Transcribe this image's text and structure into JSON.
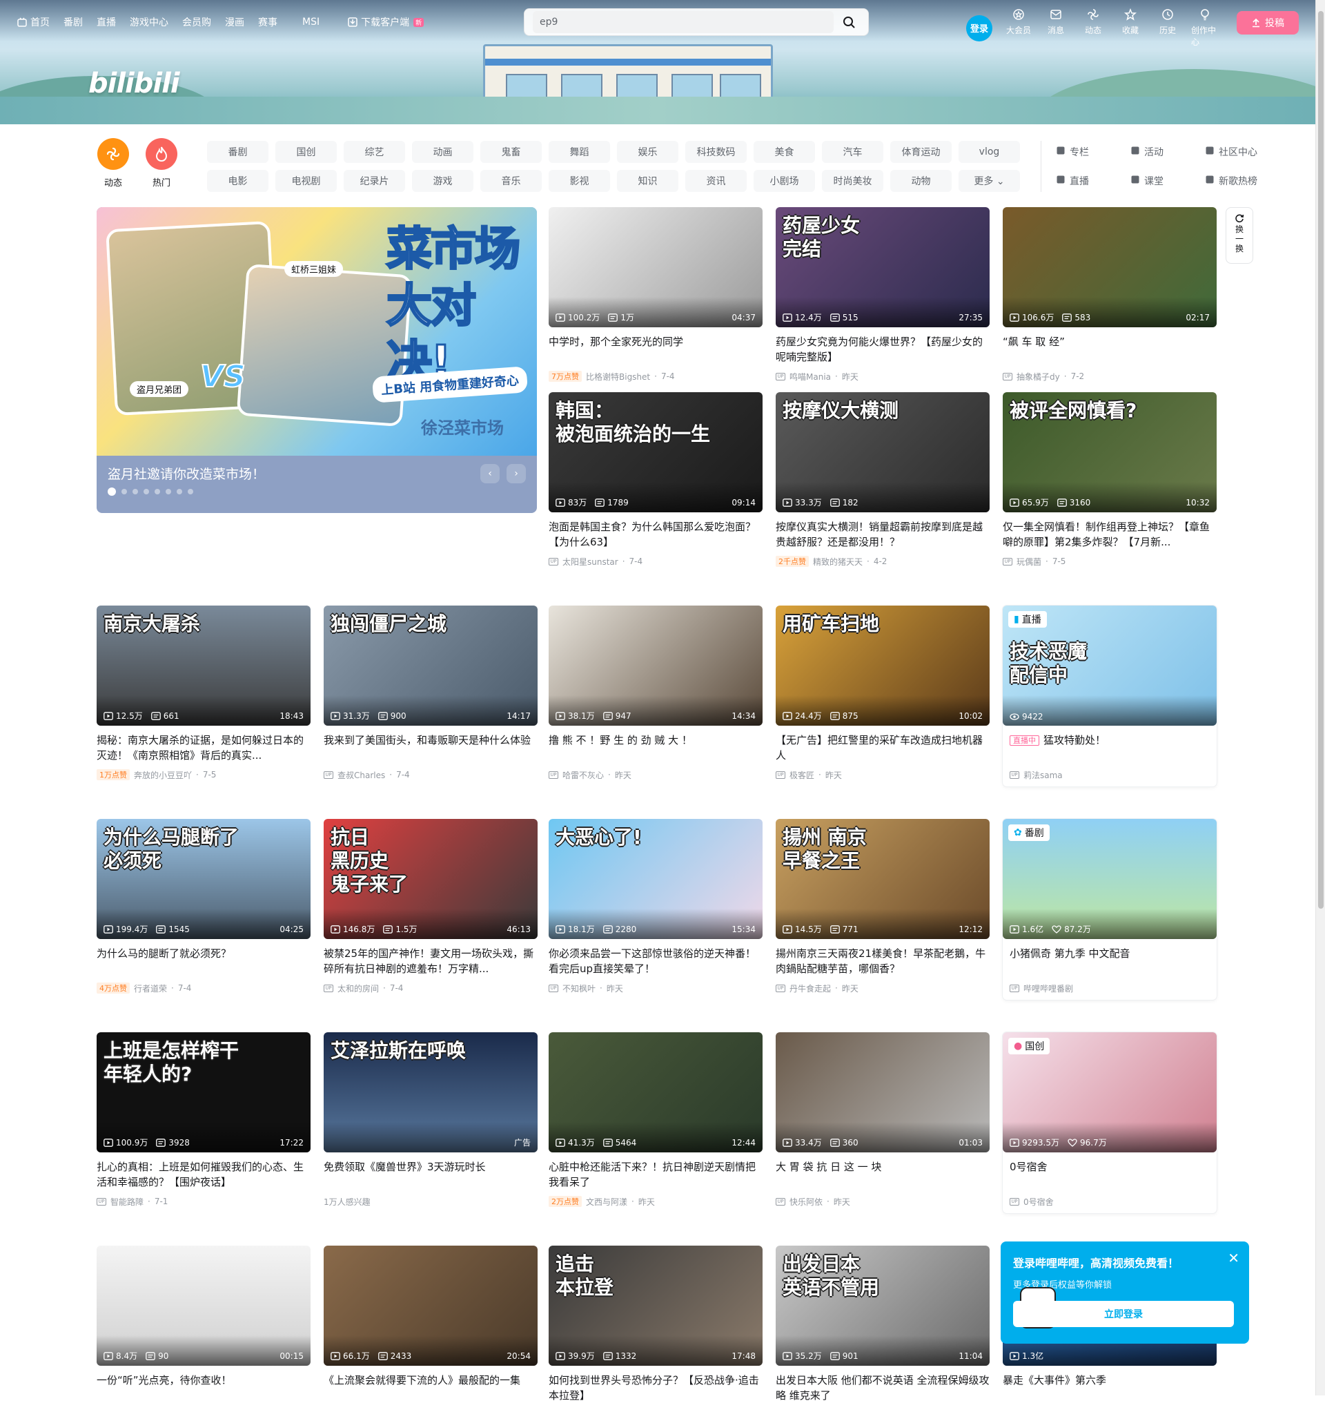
{
  "header": {
    "nav": [
      {
        "label": "首页",
        "icon": "home-icon"
      },
      {
        "label": "番剧"
      },
      {
        "label": "直播"
      },
      {
        "label": "游戏中心"
      },
      {
        "label": "会员购"
      },
      {
        "label": "漫画"
      },
      {
        "label": "赛事"
      },
      {
        "label": "MSI"
      },
      {
        "label": "下载客户端",
        "icon": "download-icon",
        "badge": "新"
      }
    ],
    "search_value": "ep9",
    "login_label": "登录",
    "right_items": [
      {
        "label": "大会员",
        "icon": "vip-icon"
      },
      {
        "label": "消息",
        "icon": "message-icon"
      },
      {
        "label": "动态",
        "icon": "dynamic-icon"
      },
      {
        "label": "收藏",
        "icon": "star-icon"
      },
      {
        "label": "历史",
        "icon": "history-icon"
      },
      {
        "label": "创作中心",
        "icon": "creator-icon"
      }
    ],
    "upload_label": "投稿",
    "logo": "bilibili"
  },
  "channels": {
    "big": [
      {
        "label": "动态",
        "color": "#ff9212"
      },
      {
        "label": "热门",
        "color": "#f9645d"
      }
    ],
    "items": [
      "番剧",
      "国创",
      "综艺",
      "动画",
      "鬼畜",
      "舞蹈",
      "娱乐",
      "科技数码",
      "美食",
      "汽车",
      "体育运动",
      "vlog",
      "电影",
      "电视剧",
      "纪录片",
      "游戏",
      "音乐",
      "影视",
      "知识",
      "资讯",
      "小剧场",
      "时尚美妆",
      "动物",
      "更多"
    ],
    "ext": [
      {
        "label": "专栏"
      },
      {
        "label": "活动"
      },
      {
        "label": "社区中心"
      },
      {
        "label": "直播"
      },
      {
        "label": "课堂"
      },
      {
        "label": "新歌热榜"
      }
    ]
  },
  "carousel": {
    "caption": "盗月社邀请你改造菜市场！",
    "art_title": "菜市场\n大对决!",
    "art_sub": "上B站 用食物重建好奇心",
    "tag_left": "盗月兄弟团",
    "tag_right": "虹桥三姐妹",
    "vs": "VS",
    "watermark": "徐泾菜市场",
    "dots": 8
  },
  "refresh_label": "换一换",
  "cards": [
    {
      "title": "中学时，那个全家死光的同学",
      "plays": "100.2万",
      "danmaku": "1万",
      "dur": "04:37",
      "author": "比格谢特Bigshet",
      "date": "7-4",
      "badge": "7万点赞",
      "thumb_text": "",
      "bg": "linear-gradient(135deg,#f0f0f0,#9a9a9a)"
    },
    {
      "title": "药屋少女究竟为何能火爆世界？【药屋少女的呢喃完整版】",
      "plays": "12.4万",
      "danmaku": "515",
      "dur": "27:35",
      "author": "鸣喵Mania",
      "date": "昨天",
      "thumb_text": "药屋少女\n完结",
      "bg": "linear-gradient(135deg,#6a4a7a,#2b2b4d)"
    },
    {
      "title": "“飙 车 取 经”",
      "plays": "106.6万",
      "danmaku": "583",
      "dur": "02:17",
      "author": "抽象橘子dy",
      "date": "7-2",
      "thumb_text": "",
      "bg": "linear-gradient(135deg,#7a5a2a,#3f6a3a)"
    },
    {
      "title": "泡面是韩国主食？为什么韩国那么爱吃泡面？【为什么63】",
      "plays": "83万",
      "danmaku": "1789",
      "dur": "09:14",
      "author": "太阳星sunstar",
      "date": "7-4",
      "thumb_text": "韩国：\n被泡面统治的一生",
      "bg": "linear-gradient(135deg,#3a3a3a,#1a1a1a)"
    },
    {
      "title": "按摩仪真实大横测！销量超霸前按摩到底是越贵越舒服？还是都没用！？",
      "plays": "33.3万",
      "danmaku": "182",
      "dur": "",
      "author": "精致的猪天天",
      "date": "4-2",
      "badge": "2千点赞",
      "thumb_text": "按摩仪大横测",
      "bg": "linear-gradient(135deg,#5a5a5a,#2a2a2a)"
    },
    {
      "title": "仅一集全网慎看！制作组再登上神坛？【章鱼噼的原罪】第2集多炸裂？【7月新...",
      "plays": "65.9万",
      "danmaku": "3160",
      "dur": "10:32",
      "author": "玩偶菌",
      "date": "7-5",
      "thumb_text": "被评全网慎看?",
      "bg": "linear-gradient(135deg,#3d5a2a,#6a7a4a)"
    },
    {
      "title": "揭秘：南京大屠杀的证据，是如何躲过日本的灭迹！《南京照相馆》背后的真实...",
      "plays": "12.5万",
      "danmaku": "661",
      "dur": "18:43",
      "author": "奔放的小豆豆吖",
      "date": "7-5",
      "badge": "1万点赞",
      "thumb_text": "南京大屠杀",
      "bg": "linear-gradient(180deg,#7a8a9a,#3a3a3a)"
    },
    {
      "title": "我来到了美国街头，和毒贩聊天是种什么体验",
      "plays": "31.3万",
      "danmaku": "900",
      "dur": "14:17",
      "author": "查叔Charles",
      "date": "7-4",
      "thumb_text": "独闯僵尸之城",
      "bg": "linear-gradient(135deg,#8a9aaa,#4a5a6a)"
    },
    {
      "title": "撸 熊 不 ！野 生 的 劲 贼 大 ！",
      "plays": "38.1万",
      "danmaku": "947",
      "dur": "14:34",
      "author": "哈雷不灰心",
      "date": "昨天",
      "thumb_text": "",
      "bg": "linear-gradient(135deg,#e8e4dc,#5a4a3a)"
    },
    {
      "title": "【无广告】把红警里的采矿车改造成扫地机器人",
      "plays": "24.4万",
      "danmaku": "875",
      "dur": "10:02",
      "author": "极客匠",
      "date": "昨天",
      "thumb_text": "用矿车扫地",
      "bg": "linear-gradient(135deg,#d9a23a,#5a3a1a)"
    },
    {
      "title": "猛攻特勤处！",
      "plays": "9422",
      "danmaku": "",
      "dur": "",
      "author": "莉法sama",
      "date": "",
      "live": "直播中",
      "corner": "直播",
      "thumb_text": "技术恶魔\n配信中",
      "bg": "linear-gradient(135deg,#bfe6f7,#7ec0e8)"
    },
    {
      "title": "为什么马的腿断了就必须死？",
      "plays": "199.4万",
      "danmaku": "1545",
      "dur": "04:25",
      "author": "行者道荣",
      "date": "7-4",
      "badge": "4万点赞",
      "thumb_text": "为什么马腿断了\n必须死",
      "bg": "linear-gradient(180deg,#9cc6e8,#4a5a6a)"
    },
    {
      "title": "被禁25年的国产神作！妻文用一场砍头戏，撕碎所有抗日神剧的遮羞布！万字精...",
      "plays": "146.8万",
      "danmaku": "1.5万",
      "dur": "46:13",
      "author": "太和的房间",
      "date": "7-4",
      "thumb_text": "抗日\n黑历史\n鬼子来了",
      "bg": "linear-gradient(135deg,#e04040,#3a3a3a)"
    },
    {
      "title": "你必须来品尝一下这部惊世骇俗的逆天神番！看完后up直接笑晕了！",
      "plays": "18.1万",
      "danmaku": "2280",
      "dur": "15:34",
      "author": "不知枫叶",
      "date": "昨天",
      "thumb_text": "大恶心了!",
      "bg": "linear-gradient(135deg,#6fc7f2,#f0d8e8)"
    },
    {
      "title": "揚州南京三天兩夜21樣美食！早茶配老鵝，牛肉鍋貼配糖芋苗，哪個香？",
      "plays": "14.5万",
      "danmaku": "771",
      "dur": "12:12",
      "author": "丹牛食走起",
      "date": "昨天",
      "thumb_text": "揚州 南京\n早餐之王",
      "bg": "linear-gradient(135deg,#c8a060,#6a4a2a)"
    },
    {
      "title": "小猪佩奇 第九季 中文配音",
      "plays": "1.6亿",
      "danmaku": "87.2万",
      "dur": "",
      "author": "哔哩哔哩番剧",
      "date": "",
      "corner": "番剧",
      "thumb_text": "",
      "bg": "linear-gradient(180deg,#8fd0f5,#bfe7a0)"
    },
    {
      "title": "扎心的真相：上班是如何摧毁我们的心态、生活和幸福感的？【围炉夜话】",
      "plays": "100.9万",
      "danmaku": "3928",
      "dur": "17:22",
      "author": "智能路障",
      "date": "7-1",
      "thumb_text": "上班是怎样榨干\n年轻人的?",
      "bg": "#111111"
    },
    {
      "title": "免费领取《魔兽世界》3天游玩时长",
      "plays": "",
      "danmaku": "",
      "dur": "广告",
      "author": "1万人感兴趣",
      "date": "",
      "ad": true,
      "thumb_text": "艾泽拉斯在呼唤",
      "bg": "linear-gradient(180deg,#1a2a4a,#5a7aa0)"
    },
    {
      "title": "心脏中枪还能活下来？！抗日神剧逆天剧情把我看呆了",
      "plays": "41.3万",
      "danmaku": "5464",
      "dur": "12:44",
      "author": "文西与阿漾",
      "date": "昨天",
      "badge": "2万点赞",
      "thumb_text": "",
      "bg": "linear-gradient(135deg,#4a5a3a,#2a3a2a)"
    },
    {
      "title": "大 胃 袋 抗 日 这 一 块",
      "plays": "33.4万",
      "danmaku": "360",
      "dur": "01:03",
      "author": "快乐阿依",
      "date": "昨天",
      "thumb_text": "",
      "bg": "linear-gradient(135deg,#6a5a4a,#bababa)"
    },
    {
      "title": "0号宿舍",
      "plays": "9293.5万",
      "danmaku": "96.7万",
      "dur": "",
      "author": "0号宿舍",
      "date": "",
      "corner": "国创",
      "thumb_text": "",
      "bg": "linear-gradient(135deg,#f5e0ea,#d08090)"
    },
    {
      "title": "一份“听”光点亮，待你查收！",
      "plays": "8.4万",
      "danmaku": "90",
      "dur": "00:15",
      "author": "",
      "date": "",
      "thumb_text": "",
      "bg": "linear-gradient(180deg,#f4f4f4,#cfcfcf)"
    },
    {
      "title": "《上流聚会就得要下流的人》最般配的一集",
      "plays": "66.1万",
      "danmaku": "2433",
      "dur": "20:54",
      "author": "",
      "date": "",
      "thumb_text": "",
      "bg": "linear-gradient(135deg,#8a6a4a,#4a3a2a)"
    },
    {
      "title": "如何找到世界头号恐怖分子？【反恐战争·追击本拉登】",
      "plays": "39.9万",
      "danmaku": "1332",
      "dur": "17:48",
      "author": "",
      "date": "",
      "thumb_text": "追击\n本拉登",
      "bg": "linear-gradient(135deg,#3a3a3a,#8a7a6a)"
    },
    {
      "title": "出发日本大阪 他们都不说英语 全流程保姆级攻略 维克来了",
      "plays": "35.2万",
      "danmaku": "901",
      "dur": "11:04",
      "author": "",
      "date": "",
      "thumb_text": "出发日本\n英语不管用",
      "bg": "linear-gradient(135deg,#c8c8c8,#6a6a6a)"
    },
    {
      "title": "暴走《大事件》第六季",
      "plays": "1.3亿",
      "danmaku": "",
      "dur": "",
      "author": "",
      "date": "",
      "thumb_text": "",
      "bg": "linear-gradient(135deg,#2a6ab0,#1a3a6a)"
    }
  ],
  "popup": {
    "title": "登录哔哩哔哩，高清视频免费看！",
    "sub": "更多登录后权益等你解锁",
    "button": "立即登录"
  }
}
